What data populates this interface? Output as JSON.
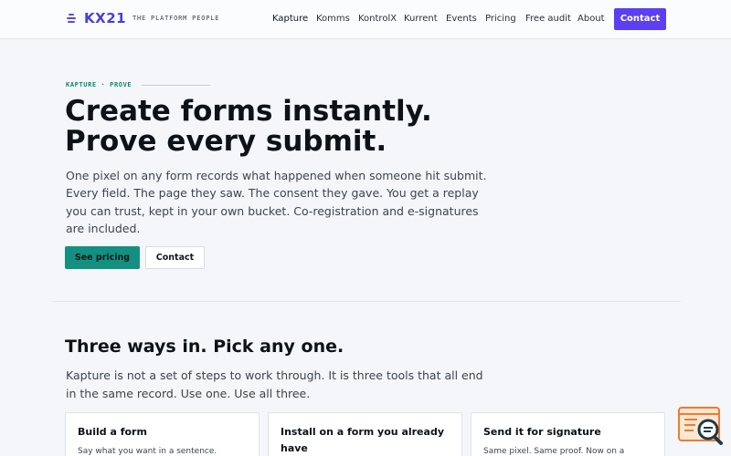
{
  "brand": {
    "name": "KX21",
    "tagline": "THE PLATFORM PEOPLE"
  },
  "nav": {
    "items": [
      "Kapture",
      "Komms",
      "KontrolX",
      "Kurrent",
      "Events",
      "Pricing",
      "Free audit",
      "About"
    ],
    "contact_label": "Contact"
  },
  "hero": {
    "eyebrow": "KAPTURE · PROVE",
    "title_line1": "Create forms instantly.",
    "title_line2": "Prove every submit.",
    "lead": "One pixel on any form records what happened when someone hit submit. Every field. The page they saw. The consent they gave. You get a replay you can trust, kept in your own bucket. Co-registration and e-signatures are included.",
    "primary_label": "See pricing",
    "secondary_label": "Contact"
  },
  "section": {
    "title": "Three ways in. Pick any one.",
    "lead": "Kapture is not a set of steps to work through. It is three tools that all end in the same record. Use one. Use all three.",
    "cards": [
      {
        "title": "Build a form",
        "body": "Say what you want in a sentence."
      },
      {
        "title": "Install on a form you already have",
        "body": ""
      },
      {
        "title": "Send it for signature",
        "body": "Same pixel. Same proof. Now on a"
      }
    ]
  },
  "colors": {
    "accent": "#5b3ff0",
    "primary_button": "#139080",
    "eyebrow": "#0f8576",
    "widget": "#f07b2a"
  }
}
